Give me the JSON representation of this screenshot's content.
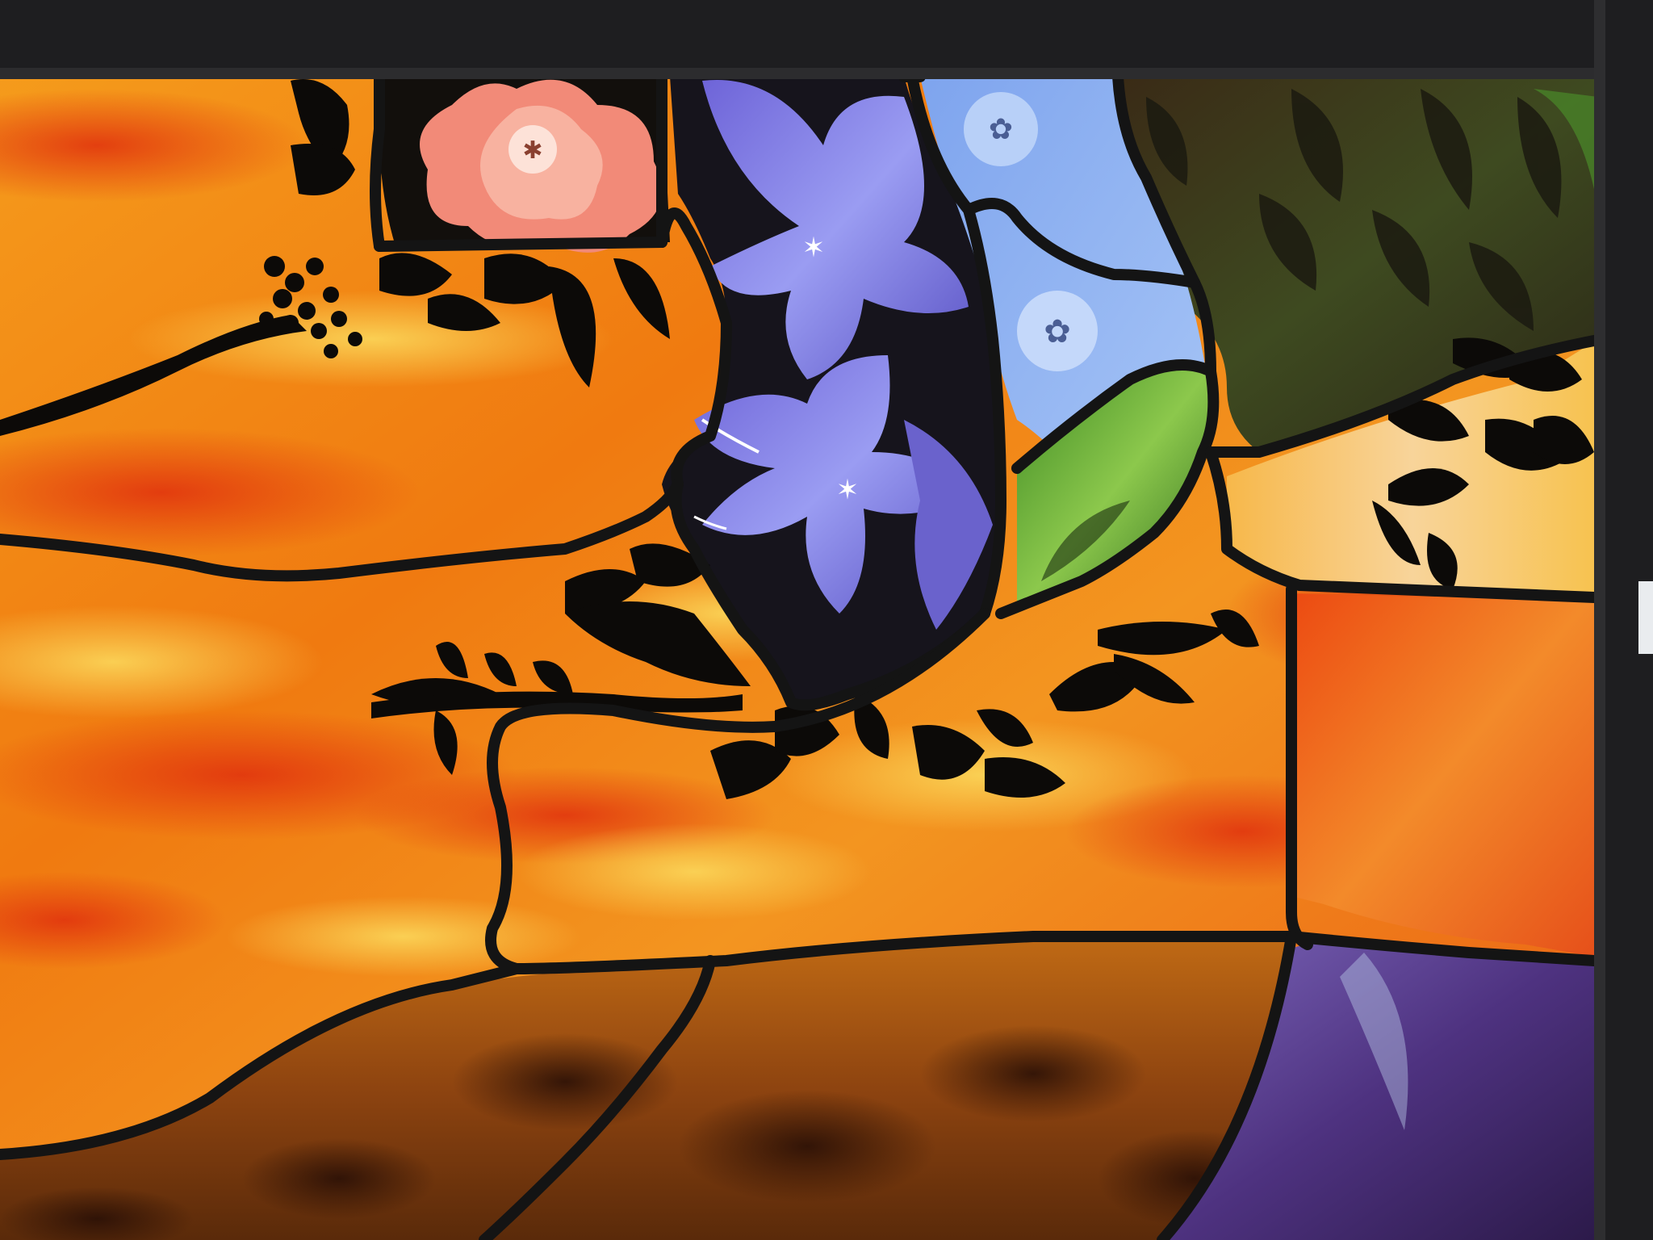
{
  "scene": {
    "subject": "stained-glass-panel",
    "palette": {
      "frame": "#1e1e20",
      "lead": "#141414",
      "sky_orange": "#f07a10",
      "sky_red": "#e43a12",
      "sky_yellow": "#f9c12c",
      "band_pale": "#f6c98a",
      "amber_wood": "#a25512",
      "amber_dark": "#3a1808",
      "purple_glass": "#5a3a8a",
      "blossom_coral": "#f28a78",
      "petal_violet": "#8a8ef0",
      "petal_blue": "#8eb6f2",
      "leaf_green": "#58a030",
      "foliage_dark": "#2c2a18"
    },
    "elements": [
      "coral-blossom-pane",
      "violet-lily-pane",
      "blue-blossom-pane",
      "green-leaf-pane",
      "black-vine-silhouettes",
      "orange-sky-panes",
      "amber-wood-pane",
      "purple-glass-pane",
      "lead-came-lines",
      "metal-frame"
    ]
  }
}
